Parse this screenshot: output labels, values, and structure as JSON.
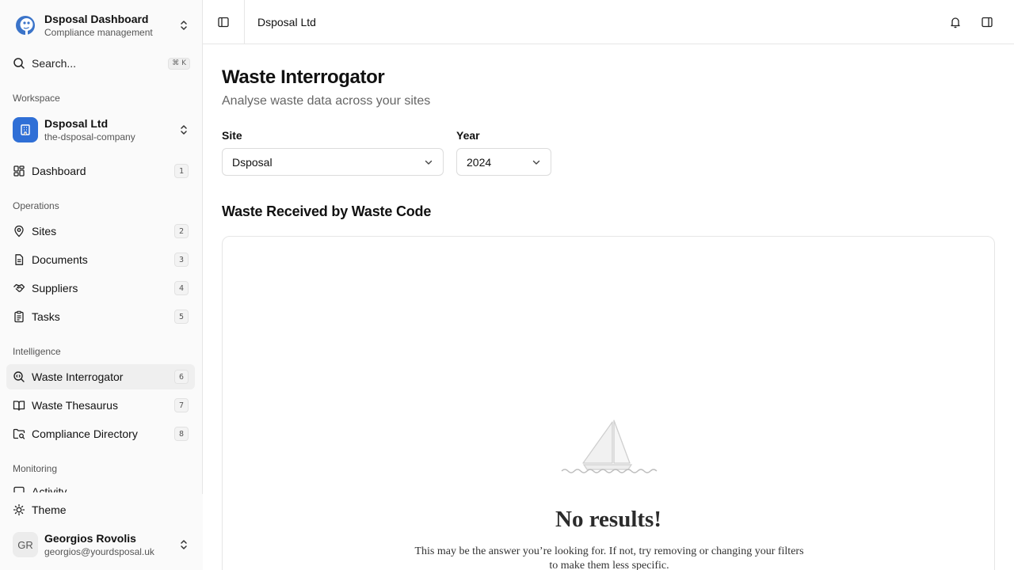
{
  "app": {
    "name": "Dsposal Dashboard",
    "subtitle": "Compliance management"
  },
  "search": {
    "label": "Search...",
    "shortcut": "⌘ K"
  },
  "workspace": {
    "section_label": "Workspace",
    "name": "Dsposal Ltd",
    "slug": "the-dsposal-company",
    "brand_color": "#2f6fd6"
  },
  "nav": {
    "dashboard": {
      "label": "Dashboard",
      "badge": "1"
    },
    "operations_label": "Operations",
    "sites": {
      "label": "Sites",
      "badge": "2"
    },
    "documents": {
      "label": "Documents",
      "badge": "3"
    },
    "suppliers": {
      "label": "Suppliers",
      "badge": "4"
    },
    "tasks": {
      "label": "Tasks",
      "badge": "5"
    },
    "intelligence_label": "Intelligence",
    "waste_interrogator": {
      "label": "Waste Interrogator",
      "badge": "6",
      "active": true
    },
    "waste_thesaurus": {
      "label": "Waste Thesaurus",
      "badge": "7"
    },
    "compliance_directory": {
      "label": "Compliance Directory",
      "badge": "8"
    },
    "monitoring_label": "Monitoring",
    "activity": {
      "label": "Activity"
    }
  },
  "theme": {
    "label": "Theme"
  },
  "user": {
    "initials": "GR",
    "name": "Georgios Rovolis",
    "email": "georgios@yourdsposal.uk"
  },
  "header": {
    "breadcrumb": "Dsposal Ltd"
  },
  "page": {
    "title": "Waste Interrogator",
    "subtitle": "Analyse waste data across your sites",
    "site_label": "Site",
    "site_value": "Dsposal",
    "year_label": "Year",
    "year_value": "2024",
    "section_title": "Waste Received by Waste Code"
  },
  "empty_state": {
    "title": "No results!",
    "description": "This may be the answer you’re looking for. If not, try removing or changing your filters to make them less specific."
  }
}
